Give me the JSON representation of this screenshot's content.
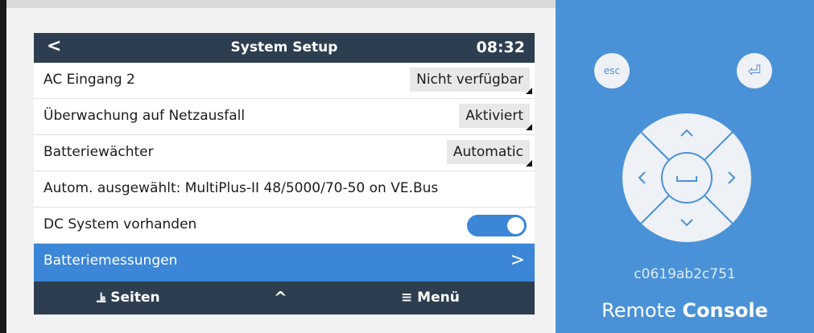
{
  "header": {
    "back_icon": "chevron-left-icon",
    "back_glyph": "<",
    "title": "System Setup",
    "time": "08:32"
  },
  "rows": [
    {
      "label": "AC Eingang 2",
      "value": "Nicht verfügbar"
    },
    {
      "label": "Überwachung auf Netzausfall",
      "value": "Aktiviert"
    },
    {
      "label": "Batteriewächter",
      "value": "Automatic"
    },
    {
      "label": "Autom. ausgewählt: MultiPlus-II 48/5000/70-50 on VE.Bus"
    },
    {
      "label": "DC System vorhanden",
      "toggle_on": true
    },
    {
      "label": "Batteriemessungen",
      "chevron": ">"
    }
  ],
  "footer": {
    "pages_icon": "⫡",
    "pages_label": "Seiten",
    "up_glyph": "^",
    "menu_icon": "≡",
    "menu_label": "Menü"
  },
  "remote": {
    "esc_label": "esc",
    "enter_glyph": "⏎",
    "device_id": "c0619ab2c751",
    "brand_light": "Remote",
    "brand_bold": "Console"
  },
  "colors": {
    "header": "#2d3e51",
    "accent": "#3b86d6",
    "panel": "#4a92d8"
  }
}
